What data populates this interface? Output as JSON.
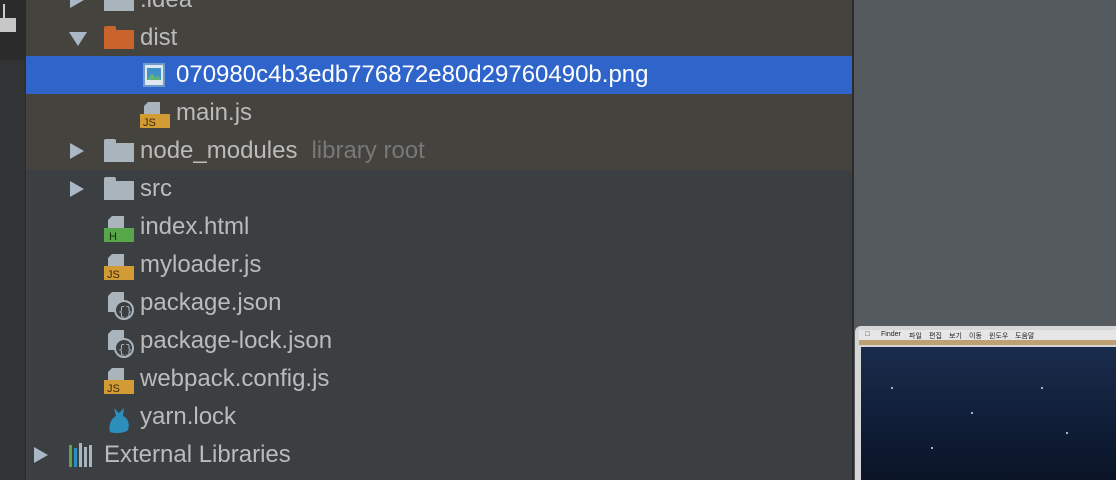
{
  "tree": {
    "rows": [
      {
        "label": ".idea",
        "icon": "folder-icon",
        "arrow": "collapsed"
      },
      {
        "label": "dist",
        "icon": "folder-icon",
        "arrow": "expanded"
      },
      {
        "label": "070980c4b3edb776872e80d29760490b.png",
        "icon": "image-file-icon",
        "selected": true
      },
      {
        "label": "main.js",
        "icon": "js-file-icon",
        "badge": "JS"
      },
      {
        "label": "node_modules",
        "hint": "library root",
        "icon": "folder-icon",
        "arrow": "collapsed"
      },
      {
        "label": "src",
        "icon": "folder-icon",
        "arrow": "collapsed"
      },
      {
        "label": "index.html",
        "icon": "html-file-icon",
        "badge": "H"
      },
      {
        "label": "myloader.js",
        "icon": "js-file-icon",
        "badge": "JS"
      },
      {
        "label": "package.json",
        "icon": "json-file-icon"
      },
      {
        "label": "package-lock.json",
        "icon": "json-file-icon"
      },
      {
        "label": "webpack.config.js",
        "icon": "js-file-icon",
        "badge": "JS"
      },
      {
        "label": "yarn.lock",
        "icon": "yarn-icon"
      },
      {
        "label": "External Libraries",
        "icon": "libraries-icon",
        "arrow": "collapsed"
      }
    ]
  },
  "colors": {
    "background": "#3c3f41",
    "selection": "#2f65ca",
    "excluded_row": "#45433e",
    "folder": "#a9b4bd",
    "dist_folder": "#c8642c",
    "js_badge": "#d39b34",
    "html_badge": "#57a64a",
    "yarn": "#2c8ebb"
  },
  "mini_screen": {
    "menu": [
      "Finder",
      "파일",
      "편집",
      "보기",
      "이동",
      "윈도우",
      "도움말"
    ]
  }
}
